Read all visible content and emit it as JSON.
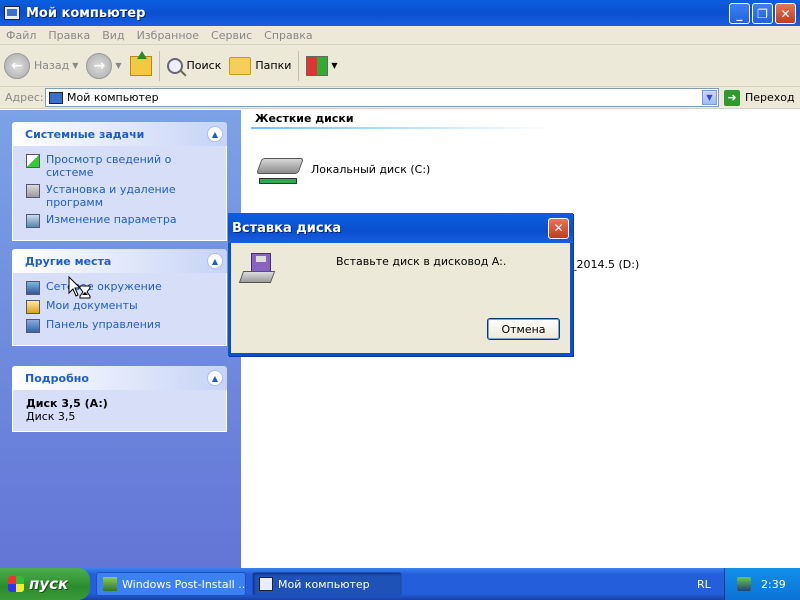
{
  "window": {
    "title": "Мой компьютер",
    "buttons": [
      "_",
      "❐",
      "✕"
    ]
  },
  "menu": [
    "Файл",
    "Правка",
    "Вид",
    "Избранное",
    "Сервис",
    "Справка"
  ],
  "toolbar": {
    "back": "Назад",
    "search": "Поиск",
    "folders": "Папки"
  },
  "address": {
    "label": "Адрес:",
    "value": "Мой компьютер",
    "go": "Переход"
  },
  "tasks": {
    "system": {
      "title": "Системные задачи",
      "items": [
        "Просмотр сведений о системе",
        "Установка и удаление программ",
        "Изменение параметра"
      ]
    },
    "other": {
      "title": "Другие места",
      "items": [
        "Сетевое окружение",
        "Мои документы",
        "Панель управления"
      ]
    },
    "details": {
      "title": "Подробно",
      "name": "Диск 3,5 (A:)",
      "type": "Диск 3,5"
    }
  },
  "main": {
    "section": "Жесткие диски",
    "drive_c": "Локальный диск (C:)",
    "drive_d_partial": "_2014.5 (D:)"
  },
  "dialog": {
    "title": "Вставка диска",
    "message": "Вставьте диск в дисковод A:.",
    "cancel": "Отмена"
  },
  "taskbar": {
    "start": "пуск",
    "tasks": [
      "Windows Post-Install ...",
      "Мой компьютер"
    ],
    "lang": "RL",
    "time": "2:39"
  }
}
